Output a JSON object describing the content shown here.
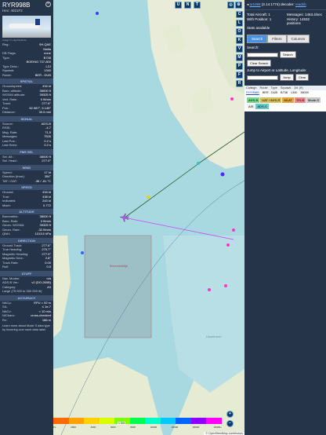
{
  "aircraft": {
    "callsign": "RYR998B",
    "hex": "Hex: 4021F2",
    "photo_credit": "Image © Luigi Dolando",
    "details": [
      {
        "k": "Reg.:",
        "v": "9H-QAE"
      },
      {
        "k": "",
        "v": "Malta"
      },
      {
        "k": "DB Flags:",
        "v": "none"
      },
      {
        "k": "Type:",
        "v": "B738"
      },
      {
        "k": "",
        "v": "BOEING 737-800"
      },
      {
        "k": "Type Desc.:",
        "v": "L2J"
      },
      {
        "k": "Squawk:",
        "v": "1340"
      },
      {
        "k": "Route:",
        "v": "BER - DUB"
      }
    ],
    "sections": [
      {
        "title": "SPATIAL",
        "rows": [
          {
            "k": "Groundspeed:",
            "v": "434 kt"
          },
          {
            "k": "Baro. altitude:",
            "v": "38000 ft"
          },
          {
            "k": "WGS84 altitude:",
            "v": "39325 ft"
          },
          {
            "k": "Vert. Rate:",
            "v": "0 ft/min"
          },
          {
            "k": "Track:",
            "v": "277.6°"
          },
          {
            "k": "Pos.:",
            "v": "52.987°, 5.145°"
          },
          {
            "k": "Distance:",
            "v": "30.6 nmi"
          }
        ]
      },
      {
        "title": "SIGNAL",
        "rows": [
          {
            "k": "Source:",
            "v": "ADS-B"
          },
          {
            "k": "RSSI:",
            "v": "-4.7"
          },
          {
            "k": "Msg. Rate:",
            "v": "71.5"
          },
          {
            "k": "Messages:",
            "v": "7526"
          },
          {
            "k": "Last Pos.:",
            "v": "0.2 s"
          },
          {
            "k": "Last Seen:",
            "v": "0.2 s"
          }
        ]
      },
      {
        "title": "FMS SEL",
        "rows": [
          {
            "k": "Sel. Alt.:",
            "v": "38000 ft"
          },
          {
            "k": "Sel. Head.:",
            "v": "277.0°"
          }
        ]
      },
      {
        "title": "WIND",
        "rows": [
          {
            "k": "Speed:",
            "v": "17 kt"
          },
          {
            "k": "Direction (from):",
            "v": "354°"
          },
          {
            "k": "TAT / OAT:",
            "v": "-36 / -61 °C"
          }
        ]
      },
      {
        "title": "SPEED",
        "rows": [
          {
            "k": "Ground:",
            "v": "434 kt"
          },
          {
            "k": "True:",
            "v": "438 kt"
          },
          {
            "k": "Indicated:",
            "v": "243 kt"
          },
          {
            "k": "Mach:",
            "v": "0.772"
          }
        ]
      },
      {
        "title": "ALTITUDE",
        "rows": [
          {
            "k": "Barometric:",
            "v": "38000 ft"
          },
          {
            "k": "Baro. Rate:",
            "v": "0 ft/min"
          },
          {
            "k": "Geom. WGS84:",
            "v": "39325 ft"
          },
          {
            "k": "Geom. Rate:",
            "v": "-32 ft/min"
          },
          {
            "k": "QNH:",
            "v": "1013.6 hPa"
          }
        ]
      },
      {
        "title": "DIRECTION",
        "rows": [
          {
            "k": "Ground Track:",
            "v": "277.6°"
          },
          {
            "k": "True Heading:",
            "v": "279.7°"
          },
          {
            "k": "Magnetic Heading:",
            "v": "277.0°"
          },
          {
            "k": "Magnetic Decl.:",
            "v": "2.8°"
          },
          {
            "k": "Track Rate:",
            "v": "0.00"
          },
          {
            "k": "Roll:",
            "v": "0.0"
          }
        ]
      },
      {
        "title": "STUFF",
        "rows": [
          {
            "k": "Nav. Modes:",
            "v": "n/a"
          },
          {
            "k": "ADS-B Ver.:",
            "v": "v2 (DO-260B)"
          },
          {
            "k": "Category:",
            "v": "A3"
          },
          {
            "k": "Large (75 000 to 300 000 lb)",
            "v": ""
          }
        ]
      },
      {
        "title": "ACCURACY",
        "rows": [
          {
            "k": "NACp:",
            "v": "EPU < 92 m"
          },
          {
            "k": "SIL:",
            "v": "≤ 1e-7"
          },
          {
            "k": "NACv:",
            "v": "< 10 m/s"
          },
          {
            "k": "NICbaro:",
            "v": "cross-checked"
          },
          {
            "k": "Rc:",
            "v": "186 m"
          }
        ]
      }
    ],
    "footer": "Learn more about Mode S data type by hovering over each data label."
  },
  "receiver": {
    "name": "ar1098",
    "version": "(3.14.1774)",
    "decoder_label": "decoder:",
    "decoder_link": "readsb",
    "stats": [
      {
        "k": "Total Aircraft:",
        "v": "1"
      },
      {
        "k": "Messages:",
        "v": "1463.4/sec"
      },
      {
        "k": "With Position:",
        "v": "1"
      },
      {
        "k": "History:",
        "v": "14532 positions"
      },
      {
        "k": "Stats available",
        "v": ""
      }
    ]
  },
  "panel": {
    "tabs": [
      "Search",
      "Filters",
      "Columns"
    ],
    "search_label": "Search:",
    "search_button": "Search",
    "clear_button": "Clear Search",
    "jump_label": "Jump to Airport or Latitude, Longitude:",
    "jump_button": "Jump",
    "jump_clear": "Clear",
    "table_headers": [
      "Callsign",
      "Route",
      "Type",
      "Squawk",
      "Alt. (ft)"
    ],
    "table_row": [
      "RYR998B",
      "BER - DUB",
      "B738",
      "1340",
      "38000"
    ],
    "legend": [
      {
        "label": "ADS-B",
        "color": "#77d98a"
      },
      {
        "label": "UAT / ADS-R",
        "color": "#d6c05a"
      },
      {
        "label": "MLAT",
        "color": "#e6a33b"
      },
      {
        "label": "TIS-B",
        "color": "#ee8888"
      },
      {
        "label": "Mode-S",
        "color": "#c8c8c8"
      },
      {
        "label": "AIS",
        "color": "#f4f4f4"
      },
      {
        "label": "ADS-C",
        "color": "#66cccc"
      }
    ]
  },
  "map": {
    "buttons_top": [
      "U",
      "N",
      "T"
    ],
    "buttons_side": [
      "C",
      "L",
      "O",
      "K",
      "V",
      "M",
      "P",
      "F",
      "R"
    ],
    "label_breezanddijk": "Breezanddijk",
    "label_ijsselmeer": "IJsselmeer",
    "scale_label": "1 NM",
    "attribution": "© OpenStreetMap contributors",
    "zoom_in": "+",
    "zoom_out": "−",
    "altitude_ticks": [
      "FL",
      "2000",
      "4000",
      "6000",
      "8000",
      "10000",
      "20000",
      "30000",
      "40000+"
    ],
    "altitude_colors": [
      "#ff6a00",
      "#ffa200",
      "#ffd200",
      "#d8ff00",
      "#7cff00",
      "#00ff50",
      "#00ffc8",
      "#00c8ff",
      "#0064ff",
      "#8c00ff",
      "#ff00ff"
    ]
  }
}
